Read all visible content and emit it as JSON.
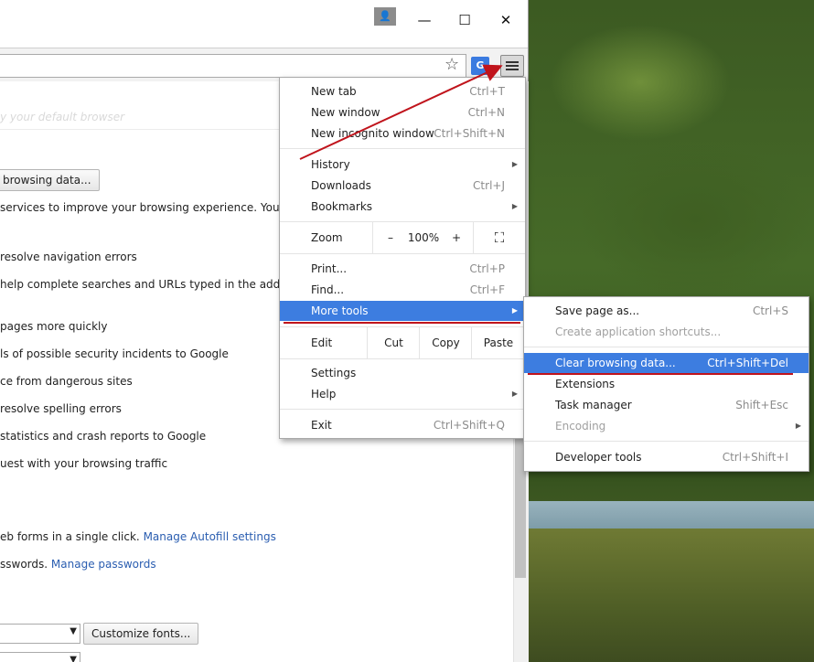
{
  "window": {
    "minimize_glyph": "—",
    "maximize_glyph": "☐",
    "close_glyph": "✕",
    "avatar_glyph": "👤",
    "toolbar": {
      "star_glyph": "☆",
      "translate_glyph": "G"
    }
  },
  "page": {
    "ghost_text": "y your default browser",
    "clear_button": "browsing data...",
    "lines": [
      {
        "text": "services to improve your browsing experience. You may op"
      },
      {
        "text": "resolve navigation errors"
      },
      {
        "text": "help complete searches and URLs typed in the address ba"
      },
      {
        "text": "pages more quickly"
      },
      {
        "text": "ls of possible security incidents to Google"
      },
      {
        "text": "ce from dangerous sites"
      },
      {
        "text": "resolve spelling errors"
      },
      {
        "text": "statistics and crash reports to Google"
      },
      {
        "text": "uest with your browsing traffic"
      }
    ],
    "autofill_text": "eb forms in a single click.",
    "autofill_link": "Manage Autofill settings",
    "passwords_text": "sswords.",
    "passwords_link": "Manage passwords",
    "customize_fonts": "Customize fonts..."
  },
  "menu": {
    "new_tab": {
      "label": "New tab",
      "shortcut": "Ctrl+T"
    },
    "new_window": {
      "label": "New window",
      "shortcut": "Ctrl+N"
    },
    "new_incognito": {
      "label": "New incognito window",
      "shortcut": "Ctrl+Shift+N"
    },
    "history": {
      "label": "History"
    },
    "downloads": {
      "label": "Downloads",
      "shortcut": "Ctrl+J"
    },
    "bookmarks": {
      "label": "Bookmarks"
    },
    "zoom": {
      "label": "Zoom",
      "minus": "–",
      "value": "100%",
      "plus": "+",
      "fullscreen": "⛶"
    },
    "print": {
      "label": "Print...",
      "shortcut": "Ctrl+P"
    },
    "find": {
      "label": "Find...",
      "shortcut": "Ctrl+F"
    },
    "more_tools": {
      "label": "More tools"
    },
    "edit": {
      "label": "Edit",
      "cut": "Cut",
      "copy": "Copy",
      "paste": "Paste"
    },
    "settings": {
      "label": "Settings"
    },
    "help": {
      "label": "Help"
    },
    "exit": {
      "label": "Exit",
      "shortcut": "Ctrl+Shift+Q"
    },
    "arrow_glyph": "▶"
  },
  "submenu": {
    "save_page": {
      "label": "Save page as...",
      "shortcut": "Ctrl+S"
    },
    "create_shortcuts": {
      "label": "Create application shortcuts..."
    },
    "clear_browsing": {
      "label": "Clear browsing data...",
      "shortcut": "Ctrl+Shift+Del"
    },
    "extensions": {
      "label": "Extensions"
    },
    "task_manager": {
      "label": "Task manager",
      "shortcut": "Shift+Esc"
    },
    "encoding": {
      "label": "Encoding"
    },
    "developer_tools": {
      "label": "Developer tools",
      "shortcut": "Ctrl+Shift+I"
    }
  },
  "colors": {
    "highlight": "#3d7de0",
    "annotation": "#c0141c"
  }
}
